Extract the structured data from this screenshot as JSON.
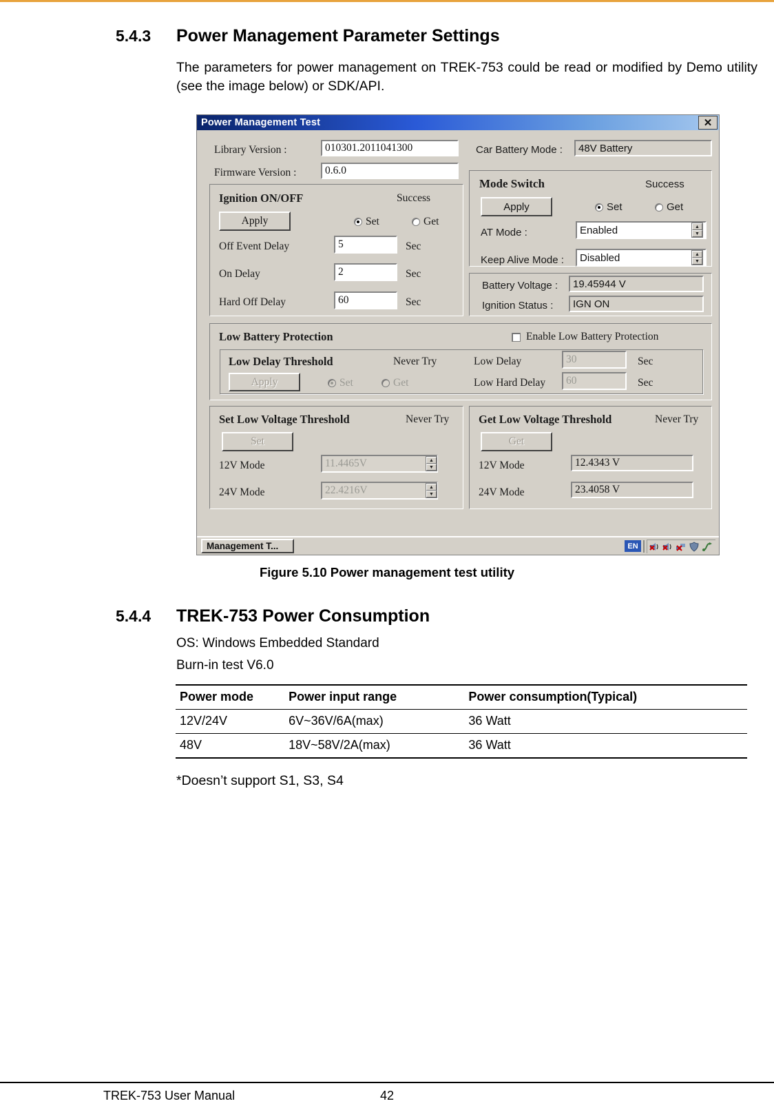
{
  "document": {
    "section_543": {
      "number": "5.4.3",
      "title": "Power Management Parameter Settings",
      "paragraph": "The parameters for power management on TREK-753 could be read or modified by Demo utility (see the image below) or SDK/API."
    },
    "figure_caption": "Figure 5.10 Power management test utility",
    "section_544": {
      "number": "5.4.4",
      "title": "TREK-753 Power Consumption",
      "line1": "OS: Windows Embedded Standard",
      "line2": "Burn-in test V6.0"
    },
    "table": {
      "headers": [
        "Power mode",
        "Power input range",
        "Power  consumption(Typical)"
      ],
      "rows": [
        [
          "12V/24V",
          "6V~36V/6A(max)",
          "36 Watt"
        ],
        [
          "48V",
          "18V~58V/2A(max)",
          "36 Watt"
        ]
      ]
    },
    "note": "*Doesn’t support S1, S3, S4",
    "footer": {
      "left": "TREK-753 User Manual",
      "page": "42"
    }
  },
  "dialog": {
    "title": "Power Management Test",
    "close_label": "✕",
    "info": {
      "library_version_label": "Library Version :",
      "library_version_value": "010301.2011041300",
      "firmware_version_label": "Firmware Version :",
      "firmware_version_value": "0.6.0",
      "car_battery_mode_label": "Car Battery Mode :",
      "car_battery_mode_value": "48V Battery"
    },
    "ignition": {
      "group_title": "Ignition ON/OFF",
      "status": "Success",
      "apply_label": "Apply",
      "set_label": "Set",
      "get_label": "Get",
      "selected": "Set",
      "rows": [
        {
          "label": "Off Event Delay",
          "value": "5",
          "unit": "Sec"
        },
        {
          "label": "On Delay",
          "value": "2",
          "unit": "Sec"
        },
        {
          "label": "Hard Off Delay",
          "value": "60",
          "unit": "Sec"
        }
      ]
    },
    "mode_switch": {
      "group_title": "Mode Switch",
      "status": "Success",
      "apply_label": "Apply",
      "set_label": "Set",
      "get_label": "Get",
      "selected": "Set",
      "at_mode_label": "AT Mode :",
      "at_mode_value": "Enabled",
      "keep_alive_label": "Keep Alive Mode :",
      "keep_alive_value": "Disabled"
    },
    "status_panel": {
      "battery_voltage_label": "Battery Voltage :",
      "battery_voltage_value": "19.45944 V",
      "ignition_status_label": "Ignition Status :",
      "ignition_status_value": "IGN ON"
    },
    "low_battery": {
      "group_title": "Low Battery Protection",
      "enable_label": "Enable Low Battery Protection",
      "enable_checked": false,
      "threshold_title": "Low Delay Threshold",
      "status": "Never Try",
      "apply_label": "Apply",
      "set_label": "Set",
      "get_label": "Get",
      "selected": "Set",
      "low_delay_label": "Low Delay",
      "low_delay_value": "30",
      "low_delay_unit": "Sec",
      "low_hard_delay_label": "Low Hard Delay",
      "low_hard_delay_value": "60",
      "low_hard_delay_unit": "Sec"
    },
    "set_low_voltage": {
      "group_title": "Set Low Voltage Threshold",
      "status": "Never Try",
      "button_label": "Set",
      "rows": [
        {
          "label": "12V Mode",
          "value": "11.4465V"
        },
        {
          "label": "24V Mode",
          "value": "22.4216V"
        }
      ]
    },
    "get_low_voltage": {
      "group_title": "Get Low Voltage Threshold",
      "status": "Never Try",
      "button_label": "Get",
      "rows": [
        {
          "label": "12V Mode",
          "value": "12.4343 V"
        },
        {
          "label": "24V Mode",
          "value": "23.4058 V"
        }
      ]
    },
    "taskbar": {
      "task_label": "Management T...",
      "language_badge": "EN",
      "tray_icons": [
        "speaker-icon",
        "speaker-icon",
        "network-icon",
        "shield-icon",
        "usb-icon"
      ]
    }
  }
}
